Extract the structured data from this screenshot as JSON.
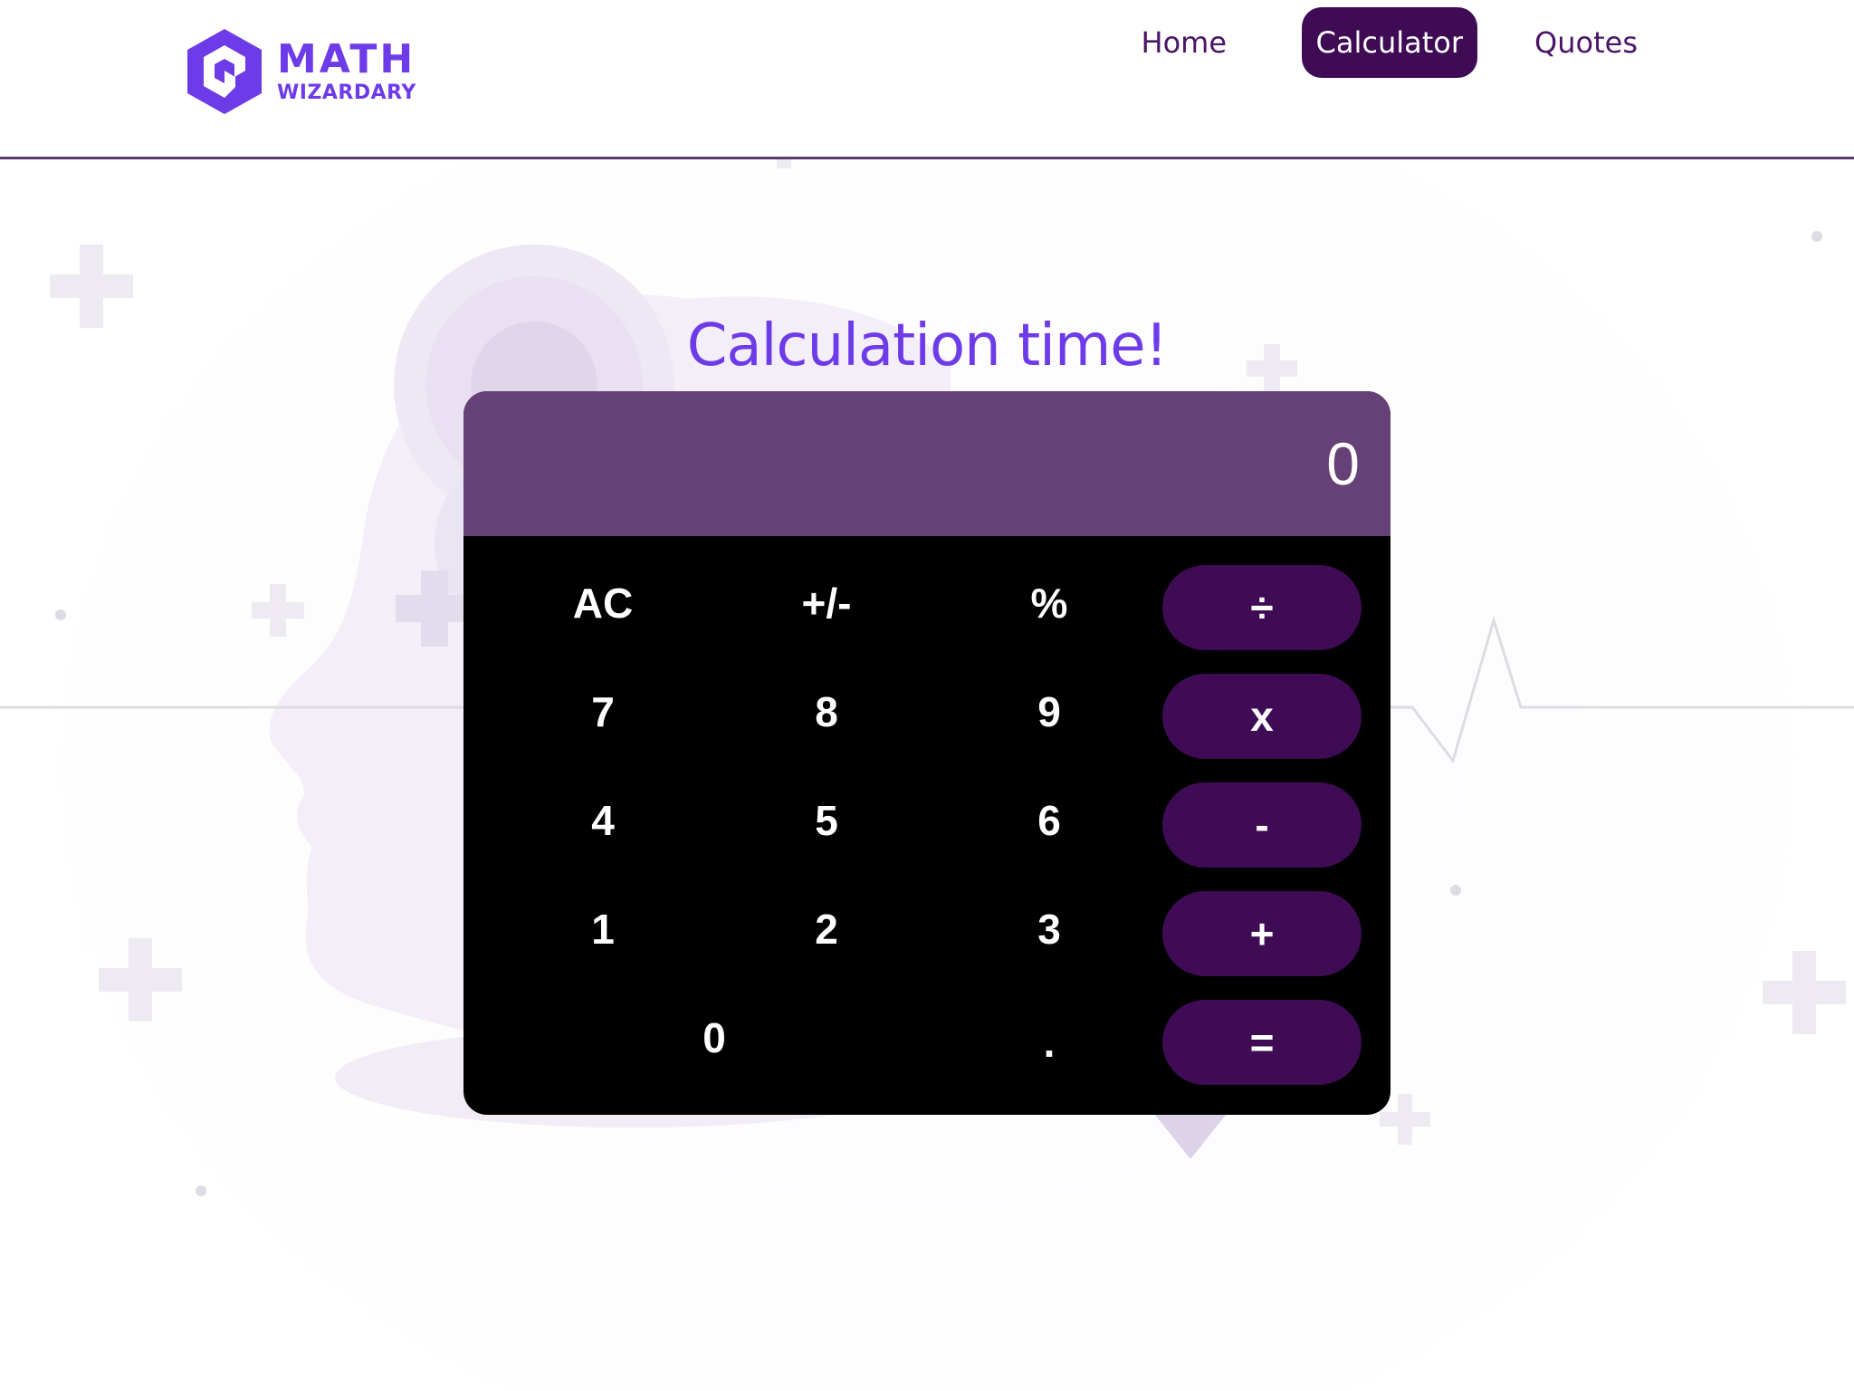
{
  "brand": {
    "title": "MATH",
    "subtitle": "WIZARDARY",
    "logo_icon": "hexagon-s-logo-icon",
    "accent_color": "#6d3be8"
  },
  "nav": {
    "items": [
      {
        "label": "Home",
        "active": false
      },
      {
        "label": "Calculator",
        "active": true
      },
      {
        "label": "Quotes",
        "active": false
      }
    ],
    "active_color": "#3f0b54"
  },
  "main": {
    "title": "Calculation time!"
  },
  "calculator": {
    "display": "0",
    "display_color": "#664177",
    "operator_color": "#3f0b54",
    "rows": [
      [
        "AC",
        "+/-",
        "%",
        "÷"
      ],
      [
        "7",
        "8",
        "9",
        "x"
      ],
      [
        "4",
        "5",
        "6",
        "-"
      ],
      [
        "1",
        "2",
        "3",
        "+"
      ],
      [
        "0",
        ".",
        "="
      ]
    ]
  }
}
